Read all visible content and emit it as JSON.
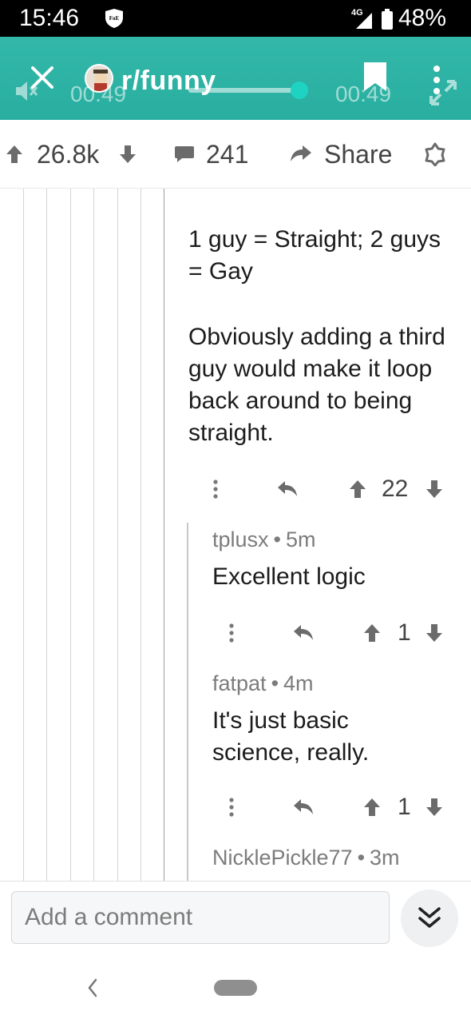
{
  "status_bar": {
    "time": "15:46",
    "network": "4G",
    "battery": "48%"
  },
  "header": {
    "subreddit": "r/funny",
    "video_time_left": "00:49",
    "video_time_right": "00:49",
    "video_progress": 1.0,
    "accent": "#2ab5a6"
  },
  "post_actions": {
    "score": "26.8k",
    "comments": "241",
    "share": "Share"
  },
  "comments": [
    {
      "body_p1": "1 guy = Straight; 2 guys = Gay",
      "body_p2": "Obviously adding a third guy would make it loop back around to being straight.",
      "score": "22"
    },
    {
      "author": "tplusx",
      "age": "5m",
      "body": "Excellent logic",
      "score": "1"
    },
    {
      "author": "fatpat",
      "age": "4m",
      "body": "It's just basic science, really.",
      "score": "1"
    },
    {
      "author": "NicklePickle77",
      "age": "3m"
    }
  ],
  "composer": {
    "placeholder": "Add a comment"
  }
}
